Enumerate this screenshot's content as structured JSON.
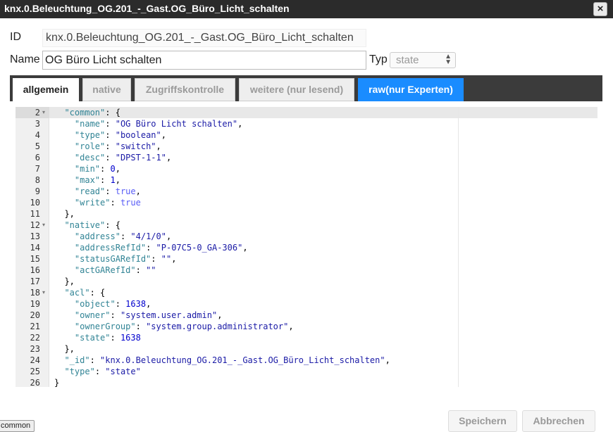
{
  "window": {
    "title": "knx.0.Beleuchtung_OG.201_-_Gast.OG_Büro_Licht_schalten",
    "close_glyph": "×"
  },
  "form": {
    "id_label": "ID",
    "id_value": "knx.0.Beleuchtung_OG.201_-_Gast.OG_Büro_Licht_schalten",
    "name_label": "Name",
    "name_value": "OG Büro Licht schalten",
    "typ_label": "Typ",
    "typ_value": "state"
  },
  "tabs": [
    {
      "label": "allgemein",
      "state": "active"
    },
    {
      "label": "native",
      "state": "inactive"
    },
    {
      "label": "Zugriffskontrolle",
      "state": "inactive"
    },
    {
      "label": "weitere (nur lesend)",
      "state": "inactive"
    },
    {
      "label": "raw(nur Experten)",
      "state": "highlighted"
    }
  ],
  "editor": {
    "active_line": 2,
    "lines": [
      {
        "n": "2",
        "fold": true,
        "tokens": [
          [
            "p",
            "  "
          ],
          [
            "key",
            "\"common\""
          ],
          [
            "p",
            ": {"
          ]
        ]
      },
      {
        "n": "3",
        "tokens": [
          [
            "p",
            "    "
          ],
          [
            "key",
            "\"name\""
          ],
          [
            "p",
            ": "
          ],
          [
            "str",
            "\"OG Büro Licht schalten\""
          ],
          [
            "p",
            ","
          ]
        ]
      },
      {
        "n": "4",
        "tokens": [
          [
            "p",
            "    "
          ],
          [
            "key",
            "\"type\""
          ],
          [
            "p",
            ": "
          ],
          [
            "str",
            "\"boolean\""
          ],
          [
            "p",
            ","
          ]
        ]
      },
      {
        "n": "5",
        "tokens": [
          [
            "p",
            "    "
          ],
          [
            "key",
            "\"role\""
          ],
          [
            "p",
            ": "
          ],
          [
            "str",
            "\"switch\""
          ],
          [
            "p",
            ","
          ]
        ]
      },
      {
        "n": "6",
        "tokens": [
          [
            "p",
            "    "
          ],
          [
            "key",
            "\"desc\""
          ],
          [
            "p",
            ": "
          ],
          [
            "str",
            "\"DPST-1-1\""
          ],
          [
            "p",
            ","
          ]
        ]
      },
      {
        "n": "7",
        "tokens": [
          [
            "p",
            "    "
          ],
          [
            "key",
            "\"min\""
          ],
          [
            "p",
            ": "
          ],
          [
            "num",
            "0"
          ],
          [
            "p",
            ","
          ]
        ]
      },
      {
        "n": "8",
        "tokens": [
          [
            "p",
            "    "
          ],
          [
            "key",
            "\"max\""
          ],
          [
            "p",
            ": "
          ],
          [
            "num",
            "1"
          ],
          [
            "p",
            ","
          ]
        ]
      },
      {
        "n": "9",
        "tokens": [
          [
            "p",
            "    "
          ],
          [
            "key",
            "\"read\""
          ],
          [
            "p",
            ": "
          ],
          [
            "bool",
            "true"
          ],
          [
            "p",
            ","
          ]
        ]
      },
      {
        "n": "10",
        "tokens": [
          [
            "p",
            "    "
          ],
          [
            "key",
            "\"write\""
          ],
          [
            "p",
            ": "
          ],
          [
            "bool",
            "true"
          ]
        ]
      },
      {
        "n": "11",
        "tokens": [
          [
            "p",
            "  },"
          ]
        ]
      },
      {
        "n": "12",
        "fold": true,
        "tokens": [
          [
            "p",
            "  "
          ],
          [
            "key",
            "\"native\""
          ],
          [
            "p",
            ": {"
          ]
        ]
      },
      {
        "n": "13",
        "tokens": [
          [
            "p",
            "    "
          ],
          [
            "key",
            "\"address\""
          ],
          [
            "p",
            ": "
          ],
          [
            "str",
            "\"4/1/0\""
          ],
          [
            "p",
            ","
          ]
        ]
      },
      {
        "n": "14",
        "tokens": [
          [
            "p",
            "    "
          ],
          [
            "key",
            "\"addressRefId\""
          ],
          [
            "p",
            ": "
          ],
          [
            "str",
            "\"P-07C5-0_GA-306\""
          ],
          [
            "p",
            ","
          ]
        ]
      },
      {
        "n": "15",
        "tokens": [
          [
            "p",
            "    "
          ],
          [
            "key",
            "\"statusGARefId\""
          ],
          [
            "p",
            ": "
          ],
          [
            "str",
            "\"\""
          ],
          [
            "p",
            ","
          ]
        ]
      },
      {
        "n": "16",
        "tokens": [
          [
            "p",
            "    "
          ],
          [
            "key",
            "\"actGARefId\""
          ],
          [
            "p",
            ": "
          ],
          [
            "str",
            "\"\""
          ]
        ]
      },
      {
        "n": "17",
        "tokens": [
          [
            "p",
            "  },"
          ]
        ]
      },
      {
        "n": "18",
        "fold": true,
        "tokens": [
          [
            "p",
            "  "
          ],
          [
            "key",
            "\"acl\""
          ],
          [
            "p",
            ": {"
          ]
        ]
      },
      {
        "n": "19",
        "tokens": [
          [
            "p",
            "    "
          ],
          [
            "key",
            "\"object\""
          ],
          [
            "p",
            ": "
          ],
          [
            "num",
            "1638"
          ],
          [
            "p",
            ","
          ]
        ]
      },
      {
        "n": "20",
        "tokens": [
          [
            "p",
            "    "
          ],
          [
            "key",
            "\"owner\""
          ],
          [
            "p",
            ": "
          ],
          [
            "str",
            "\"system.user.admin\""
          ],
          [
            "p",
            ","
          ]
        ]
      },
      {
        "n": "21",
        "tokens": [
          [
            "p",
            "    "
          ],
          [
            "key",
            "\"ownerGroup\""
          ],
          [
            "p",
            ": "
          ],
          [
            "str",
            "\"system.group.administrator\""
          ],
          [
            "p",
            ","
          ]
        ]
      },
      {
        "n": "22",
        "tokens": [
          [
            "p",
            "    "
          ],
          [
            "key",
            "\"state\""
          ],
          [
            "p",
            ": "
          ],
          [
            "num",
            "1638"
          ]
        ]
      },
      {
        "n": "23",
        "tokens": [
          [
            "p",
            "  },"
          ]
        ]
      },
      {
        "n": "24",
        "tokens": [
          [
            "p",
            "  "
          ],
          [
            "key",
            "\"_id\""
          ],
          [
            "p",
            ": "
          ],
          [
            "str",
            "\"knx.0.Beleuchtung_OG.201_-_Gast.OG_Büro_Licht_schalten\""
          ],
          [
            "p",
            ","
          ]
        ]
      },
      {
        "n": "25",
        "tokens": [
          [
            "p",
            "  "
          ],
          [
            "key",
            "\"type\""
          ],
          [
            "p",
            ": "
          ],
          [
            "str",
            "\"state\""
          ]
        ]
      },
      {
        "n": "26",
        "tokens": [
          [
            "p",
            "}"
          ]
        ]
      }
    ]
  },
  "buttons": {
    "save_label": "Speichern",
    "cancel_label": "Abbrechen"
  },
  "status": {
    "badge_label": "common"
  },
  "colors": {
    "titlebar": "#2b2b2b",
    "tab_highlight": "#1a8cff",
    "tabbar": "#3b3b3b"
  }
}
